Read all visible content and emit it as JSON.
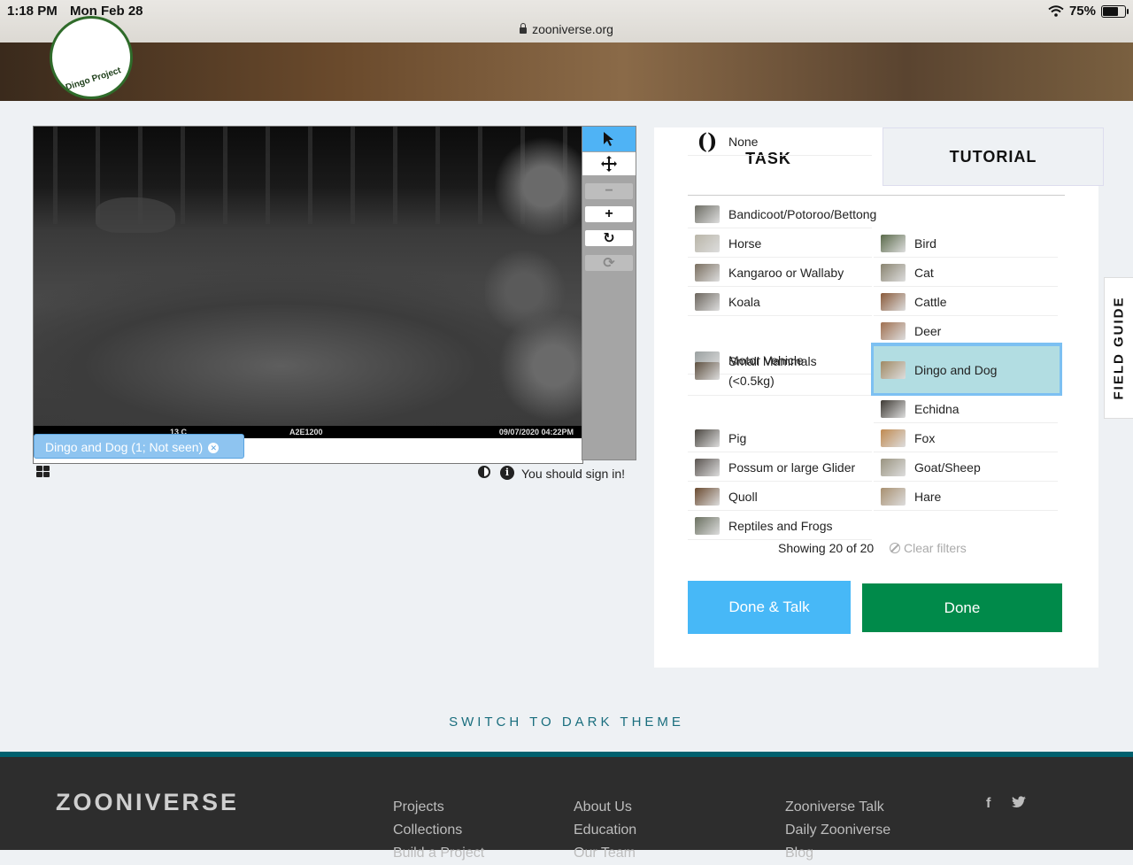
{
  "status_bar": {
    "time": "1:18 PM",
    "date": "Mon Feb 28",
    "battery": "75%",
    "battery_level": 0.75,
    "url": "zooniverse.org"
  },
  "banner": {
    "logo_text": "Dingo Project"
  },
  "viewer": {
    "strip": {
      "temp": "13 C",
      "camera": "A2E1200",
      "datetime": "09/07/2020 04:22PM"
    },
    "mark_label": "Dingo and Dog (1; Not seen)",
    "signin_text": "You should sign in!"
  },
  "tabs": {
    "task": "TASK",
    "tutorial": "TUTORIAL"
  },
  "choices": [
    {
      "label": "Bandicoot/Potoroo/Bettong",
      "col": "left",
      "color": "#6d6d64"
    },
    {
      "label": "Horse",
      "col": "left",
      "color": "#b9b5a8"
    },
    {
      "label": "Bird",
      "col": "right",
      "color": "#5a6a4a"
    },
    {
      "label": "Kangaroo or Wallaby",
      "col": "left",
      "color": "#7a6f60"
    },
    {
      "label": "Cat",
      "col": "right",
      "color": "#8a8470"
    },
    {
      "label": "Koala",
      "col": "left",
      "color": "#6c665e"
    },
    {
      "label": "Cattle",
      "col": "right",
      "color": "#8a5a3a"
    },
    {
      "label": "Motor Vehicle",
      "col": "left",
      "color": "#9aa0a0"
    },
    {
      "label": "Deer",
      "col": "right",
      "color": "#a07050"
    },
    {
      "label": "Small Mammals (<0.5kg)",
      "col": "left",
      "color": "#5e5040"
    },
    {
      "label": "Dingo and Dog",
      "col": "right",
      "color": "#a08a64",
      "selected": true
    },
    {
      "label": "Pig",
      "col": "left",
      "color": "#4a4640"
    },
    {
      "label": "Echidna",
      "col": "right",
      "color": "#3e3a34"
    },
    {
      "label": "Possum or large Glider",
      "col": "left",
      "color": "#5a5450"
    },
    {
      "label": "Fox",
      "col": "right",
      "color": "#c08a50"
    },
    {
      "label": "Quoll",
      "col": "left",
      "color": "#6a4a30"
    },
    {
      "label": "Goat/Sheep",
      "col": "right",
      "color": "#9a9480"
    },
    {
      "label": "Reptiles and Frogs",
      "col": "left",
      "color": "#6a7060"
    },
    {
      "label": "Hare",
      "col": "right",
      "color": "#a89070"
    },
    {
      "label": "None",
      "col": "left",
      "glyph": "()"
    }
  ],
  "filters": {
    "showing": "Showing 20 of 20",
    "clear": "Clear filters"
  },
  "buttons": {
    "done_talk": "Done & Talk",
    "done": "Done"
  },
  "field_guide": "FIELD GUIDE",
  "dark_theme": "SWITCH TO DARK THEME",
  "footer": {
    "brand": "ZOONIVERSE",
    "col1": [
      "Projects",
      "Collections",
      "Build a Project"
    ],
    "col2": [
      "About Us",
      "Education",
      "Our Team"
    ],
    "col3": [
      "Zooniverse Talk",
      "Daily Zooniverse",
      "Blog"
    ],
    "social": {
      "facebook": "f",
      "twitter": "t"
    }
  }
}
